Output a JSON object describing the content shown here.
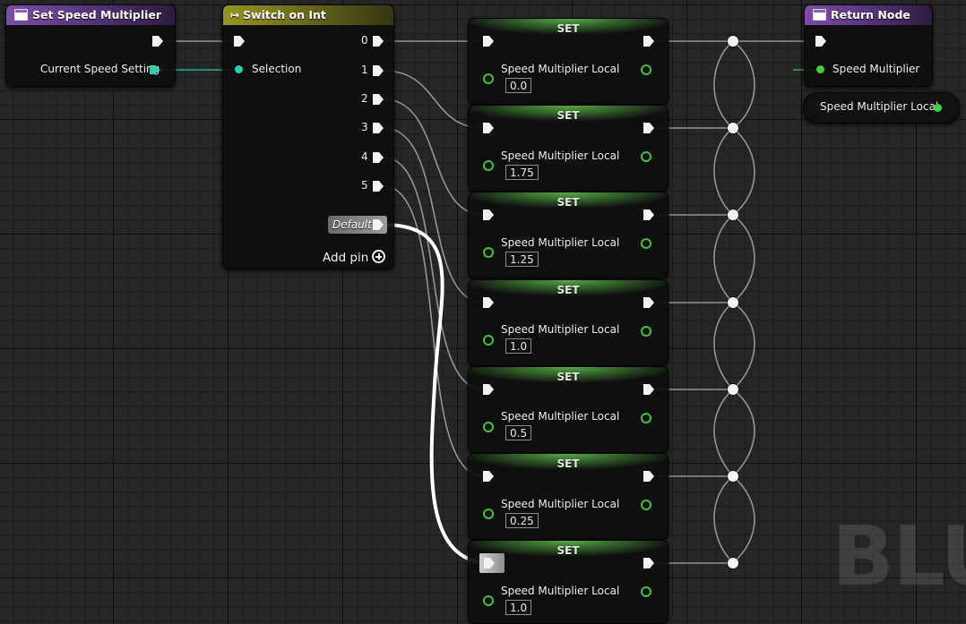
{
  "watermark": "BLU",
  "set_speed_node": {
    "title": "Set Speed Multiplier",
    "input_label": "Current Speed Setting"
  },
  "switch_node": {
    "title": "Switch on Int",
    "selection_label": "Selection",
    "cases": [
      "0",
      "1",
      "2",
      "3",
      "4",
      "5"
    ],
    "default_label": "Default",
    "add_pin_label": "Add pin"
  },
  "set_nodes": [
    {
      "title": "SET",
      "var": "Speed Multiplier Local",
      "value": "0.0"
    },
    {
      "title": "SET",
      "var": "Speed Multiplier Local",
      "value": "1.75"
    },
    {
      "title": "SET",
      "var": "Speed Multiplier Local",
      "value": "1.25"
    },
    {
      "title": "SET",
      "var": "Speed Multiplier Local",
      "value": "1.0"
    },
    {
      "title": "SET",
      "var": "Speed Multiplier Local",
      "value": "0.5"
    },
    {
      "title": "SET",
      "var": "Speed Multiplier Local",
      "value": "0.25"
    },
    {
      "title": "SET",
      "var": "Speed Multiplier Local",
      "value": "1.0"
    }
  ],
  "return_node": {
    "title": "Return Node",
    "output_label": "Speed Multiplier"
  },
  "getter_node": {
    "label": "Speed Multiplier Local"
  },
  "colors": {
    "exec": "#f2f2f2",
    "int_pin": "#27d3b0",
    "float_pin": "#3fd23a",
    "function_header": "#7d4fa6",
    "switch_header": "#969622",
    "set_header": "#5aa64a"
  }
}
